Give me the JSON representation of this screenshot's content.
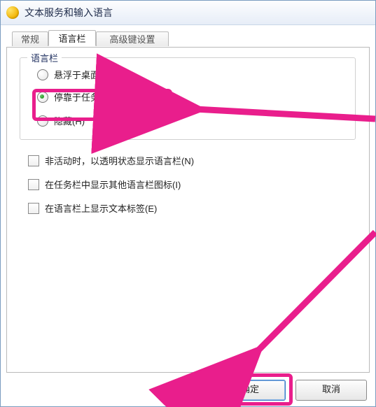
{
  "window": {
    "title": "文本服务和输入语言"
  },
  "tabs": {
    "t1": "常规",
    "t2": "语言栏",
    "t3": "高级键设置"
  },
  "group": {
    "legend": "语言栏",
    "radio_float": "悬浮于桌面上(F)",
    "radio_dock": "停靠于任务栏(D)",
    "radio_hide": "隐藏(H)"
  },
  "checks": {
    "inactive_transparent": "非活动时，以透明状态显示语言栏(N)",
    "other_icons": "在任务栏中显示其他语言栏图标(I)",
    "text_labels": "在语言栏上显示文本标签(E)"
  },
  "buttons": {
    "ok": "确定",
    "cancel": "取消"
  },
  "state": {
    "selected_radio": "dock",
    "active_tab": "t2"
  },
  "colors": {
    "highlight": "#e91e8c"
  }
}
